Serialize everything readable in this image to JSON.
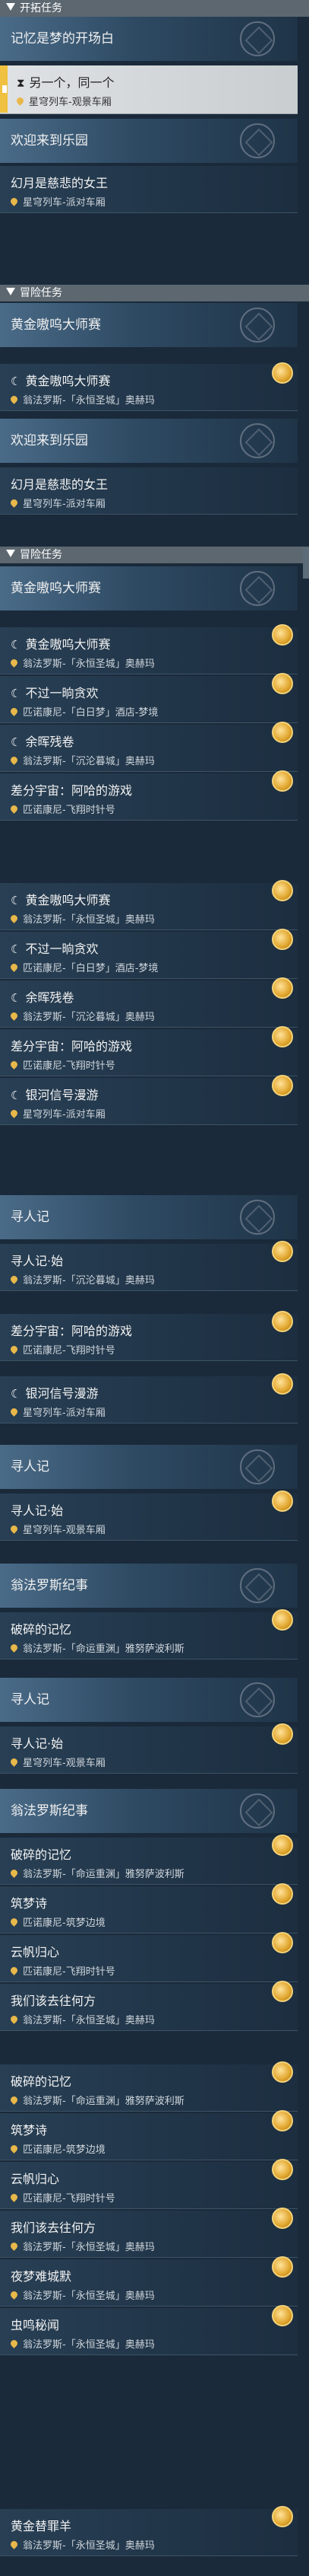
{
  "sections": [
    {
      "id": "s0",
      "label": "开拓任务"
    },
    {
      "id": "s1",
      "label": "冒险任务"
    },
    {
      "id": "s2",
      "label": "冒险任务"
    }
  ],
  "groups": {
    "g_memory": "记忆是梦的开场白",
    "g_welcome": "欢迎来到乐园",
    "g_welcome2": "欢迎来到乐园",
    "g_golden": "黄金嗷呜大师赛",
    "g_golden2": "黄金嗷呜大师赛",
    "g_xunren1": "寻人记",
    "g_xunren2": "寻人记",
    "g_xunren3": "寻人记",
    "g_wfl1": "翁法罗斯纪事",
    "g_wfl2": "翁法罗斯纪事"
  },
  "items": {
    "i01": {
      "title": "另一个，同一个",
      "loc": "星穹列车-观景车厢",
      "icon": "hourglass-icon"
    },
    "i02": {
      "title": "幻月是慈悲的女王",
      "loc": "星穹列车-派对车厢"
    },
    "i03": {
      "title": "黄金嗷呜大师赛",
      "loc": "翁法罗斯-「永恒圣城」奥赫玛",
      "icon": "mask-icon"
    },
    "i04": {
      "title": "幻月是慈悲的女王",
      "loc": "星穹列车-派对车厢"
    },
    "i05": {
      "title": "黄金嗷呜大师赛",
      "loc": "翁法罗斯-「永恒圣城」奥赫玛",
      "icon": "mask-icon"
    },
    "i06": {
      "title": "不过一晌贪欢",
      "loc": "匹诺康尼-「白日梦」酒店-梦境",
      "icon": "mask-icon"
    },
    "i07": {
      "title": "余晖残卷",
      "loc": "翁法罗斯-「沉沦暮城」奥赫玛",
      "icon": "mask-icon"
    },
    "i08": {
      "title": "差分宇宙：阿哈的游戏",
      "loc": "匹诺康尼-飞翔时针号"
    },
    "i09": {
      "title": "黄金嗷呜大师赛",
      "loc": "翁法罗斯-「永恒圣城」奥赫玛",
      "icon": "mask-icon"
    },
    "i10": {
      "title": "不过一晌贪欢",
      "loc": "匹诺康尼-「白日梦」酒店-梦境",
      "icon": "mask-icon"
    },
    "i11": {
      "title": "余晖残卷",
      "loc": "翁法罗斯-「沉沦暮城」奥赫玛",
      "icon": "mask-icon"
    },
    "i12": {
      "title": "差分宇宙：阿哈的游戏",
      "loc": "匹诺康尼-飞翔时针号"
    },
    "i13": {
      "title": "银河信号漫游",
      "loc": "星穹列车-派对车厢",
      "icon": "mask-icon"
    },
    "i14": {
      "title": "寻人记·始",
      "loc": "翁法罗斯-「沉沦暮城」奥赫玛"
    },
    "i15": {
      "title": "差分宇宙：阿哈的游戏",
      "loc": "匹诺康尼-飞翔时针号"
    },
    "i16": {
      "title": "银河信号漫游",
      "loc": "星穹列车-派对车厢",
      "icon": "mask-icon"
    },
    "i17": {
      "title": "寻人记·始",
      "loc": "星穹列车-观景车厢"
    },
    "i18": {
      "title": "破碎的记忆",
      "loc": "翁法罗斯-「命运重渊」雅努萨波利斯"
    },
    "i19": {
      "title": "寻人记·始",
      "loc": "星穹列车-观景车厢"
    },
    "i20": {
      "title": "破碎的记忆",
      "loc": "翁法罗斯-「命运重渊」雅努萨波利斯"
    },
    "i21": {
      "title": "筑梦诗",
      "loc": "匹诺康尼-筑梦边境"
    },
    "i22": {
      "title": "云帆归心",
      "loc": "匹诺康尼-飞翔时针号"
    },
    "i23": {
      "title": "我们该去往何方",
      "loc": "翁法罗斯-「永恒圣城」奥赫玛"
    },
    "i24": {
      "title": "破碎的记忆",
      "loc": "翁法罗斯-「命运重渊」雅努萨波利斯"
    },
    "i25": {
      "title": "筑梦诗",
      "loc": "匹诺康尼-筑梦边境"
    },
    "i26": {
      "title": "云帆归心",
      "loc": "匹诺康尼-飞翔时针号"
    },
    "i27": {
      "title": "我们该去往何方",
      "loc": "翁法罗斯-「永恒圣城」奥赫玛"
    },
    "i28": {
      "title": "夜梦难城默",
      "loc": "翁法罗斯-「永恒圣城」奥赫玛"
    },
    "i29": {
      "title": "虫鸣秘闻",
      "loc": "翁法罗斯-「永恒圣城」奥赫玛"
    },
    "i30": {
      "title": "黄金替罪羊",
      "loc": "翁法罗斯-「永恒圣城」奥赫玛"
    }
  },
  "colors": {
    "accent": "#f0c040",
    "coin": "#e0a52c"
  }
}
